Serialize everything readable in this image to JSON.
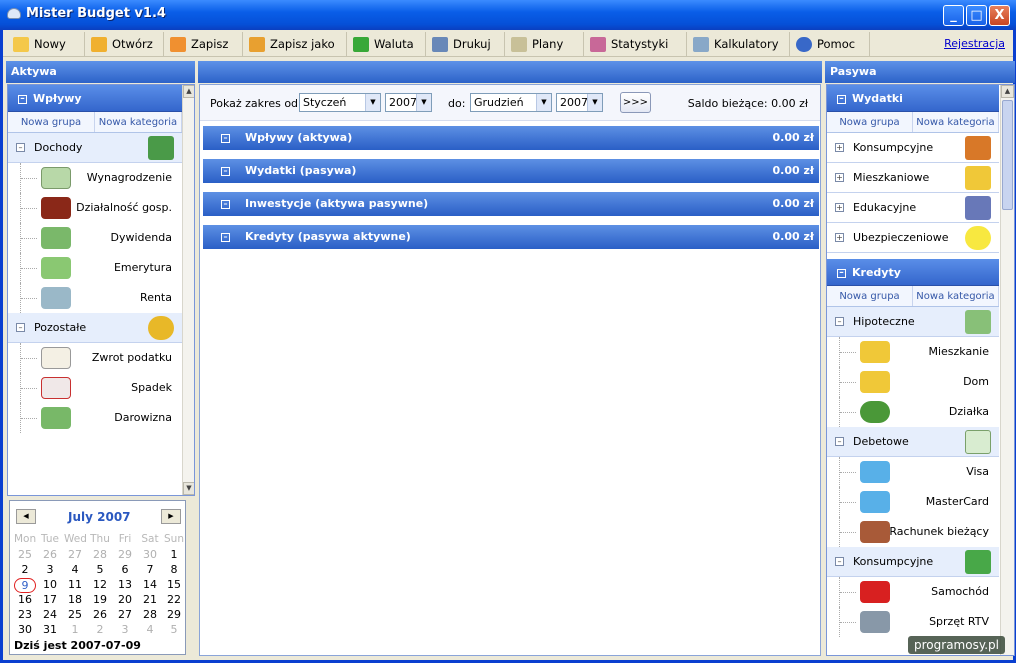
{
  "window": {
    "title": "Mister Budget v1.4",
    "minimize": "_",
    "maximize": "□",
    "close": "X"
  },
  "toolbar": {
    "items": [
      {
        "label": "Nowy",
        "icon": "folder-icon",
        "color": "#f4c84a"
      },
      {
        "label": "Otwórz",
        "icon": "open-folder-icon",
        "color": "#f0b030"
      },
      {
        "label": "Zapisz",
        "icon": "save-icon",
        "color": "#f09030"
      },
      {
        "label": "Zapisz jako",
        "icon": "save-as-icon",
        "color": "#e8a030"
      },
      {
        "label": "Waluta",
        "icon": "money-bag-icon",
        "color": "#38a838"
      },
      {
        "label": "Drukuj",
        "icon": "printer-icon",
        "color": "#6888b8"
      },
      {
        "label": "Plany",
        "icon": "scroll-icon",
        "color": "#c8c098"
      },
      {
        "label": "Statystyki",
        "icon": "chart-icon",
        "color": "#c86898"
      },
      {
        "label": "Kalkulatory",
        "icon": "calculator-icon",
        "color": "#88a8c8"
      },
      {
        "label": "Pomoc",
        "icon": "help-icon",
        "color": "#3868c8"
      }
    ],
    "register": "Rejestracja"
  },
  "left": {
    "header": "Aktywa",
    "group": "Wpływy",
    "links": [
      "Nowa grupa",
      "Nowa kategoria"
    ],
    "categories": [
      {
        "name": "Dochody",
        "icon": "money-stack-icon",
        "items": [
          {
            "label": "Wynagrodzenie",
            "icon": "envelope-money-icon"
          },
          {
            "label": "Działalność gosp.",
            "icon": "briefcase-icon"
          },
          {
            "label": "Dywidenda",
            "icon": "banknotes-icon"
          },
          {
            "label": "Emerytura",
            "icon": "banknotes-icon"
          },
          {
            "label": "Renta",
            "icon": "bill-icon"
          }
        ]
      },
      {
        "name": "Pozostałe",
        "icon": "coins-icon",
        "items": [
          {
            "label": "Zwrot podatku",
            "icon": "document-icon"
          },
          {
            "label": "Spadek",
            "icon": "gift-icon"
          },
          {
            "label": "Darowizna",
            "icon": "hand-money-icon"
          }
        ]
      }
    ]
  },
  "calendar": {
    "month": "July 2007",
    "dow": [
      "Mon",
      "Tue",
      "Wed",
      "Thu",
      "Fri",
      "Sat",
      "Sun"
    ],
    "weeks": [
      [
        "25",
        "26",
        "27",
        "28",
        "29",
        "30",
        "1"
      ],
      [
        "2",
        "3",
        "4",
        "5",
        "6",
        "7",
        "8"
      ],
      [
        "9",
        "10",
        "11",
        "12",
        "13",
        "14",
        "15"
      ],
      [
        "16",
        "17",
        "18",
        "19",
        "20",
        "21",
        "22"
      ],
      [
        "23",
        "24",
        "25",
        "26",
        "27",
        "28",
        "29"
      ],
      [
        "30",
        "31",
        "1",
        "2",
        "3",
        "4",
        "5"
      ]
    ],
    "today_text": "Dziś jest 2007-07-09"
  },
  "center": {
    "range_label": "Pokaż zakres od:",
    "from_month": "Styczeń",
    "from_year": "2007",
    "to_label": "do:",
    "to_month": "Grudzień",
    "to_year": "2007",
    "go": ">>>",
    "balance": "Saldo bieżące: 0.00 zł",
    "sections": [
      {
        "title": "Wpływy (aktywa)",
        "value": "0.00 zł"
      },
      {
        "title": "Wydatki (pasywa)",
        "value": "0.00 zł"
      },
      {
        "title": "Inwestycje (aktywa pasywne)",
        "value": "0.00 zł"
      },
      {
        "title": "Kredyty (pasywa aktywne)",
        "value": "0.00 zł"
      }
    ]
  },
  "right": {
    "header": "Pasywa",
    "wydatki": {
      "title": "Wydatki",
      "links": [
        "Nowa grupa",
        "Nowa kategoria"
      ],
      "cats": [
        {
          "name": "Konsumpcyjne",
          "icon": "books-icon"
        },
        {
          "name": "Mieszkaniowe",
          "icon": "house-icon"
        },
        {
          "name": "Edukacyjne",
          "icon": "computer-icon"
        },
        {
          "name": "Ubezpieczeniowe",
          "icon": "lightbulb-icon"
        }
      ]
    },
    "kredyty": {
      "title": "Kredyty",
      "links": [
        "Nowa grupa",
        "Nowa kategoria"
      ],
      "groups": [
        {
          "name": "Hipoteczne",
          "icon": "hand-money-icon",
          "items": [
            {
              "label": "Mieszkanie",
              "icon": "house-icon"
            },
            {
              "label": "Dom",
              "icon": "house-icon"
            },
            {
              "label": "Działka",
              "icon": "tree-icon"
            }
          ]
        },
        {
          "name": "Debetowe",
          "icon": "envelope-icon",
          "items": [
            {
              "label": "Visa",
              "icon": "credit-card-icon"
            },
            {
              "label": "MasterCard",
              "icon": "credit-card-icon"
            },
            {
              "label": "Rachunek bieżący",
              "icon": "wallet-icon"
            }
          ]
        },
        {
          "name": "Konsumpcyjne",
          "icon": "books-icon",
          "items": [
            {
              "label": "Samochód",
              "icon": "car-icon"
            },
            {
              "label": "Sprzęt RTV",
              "icon": "tv-icon"
            }
          ]
        }
      ]
    }
  },
  "watermark": "programosy.pl"
}
